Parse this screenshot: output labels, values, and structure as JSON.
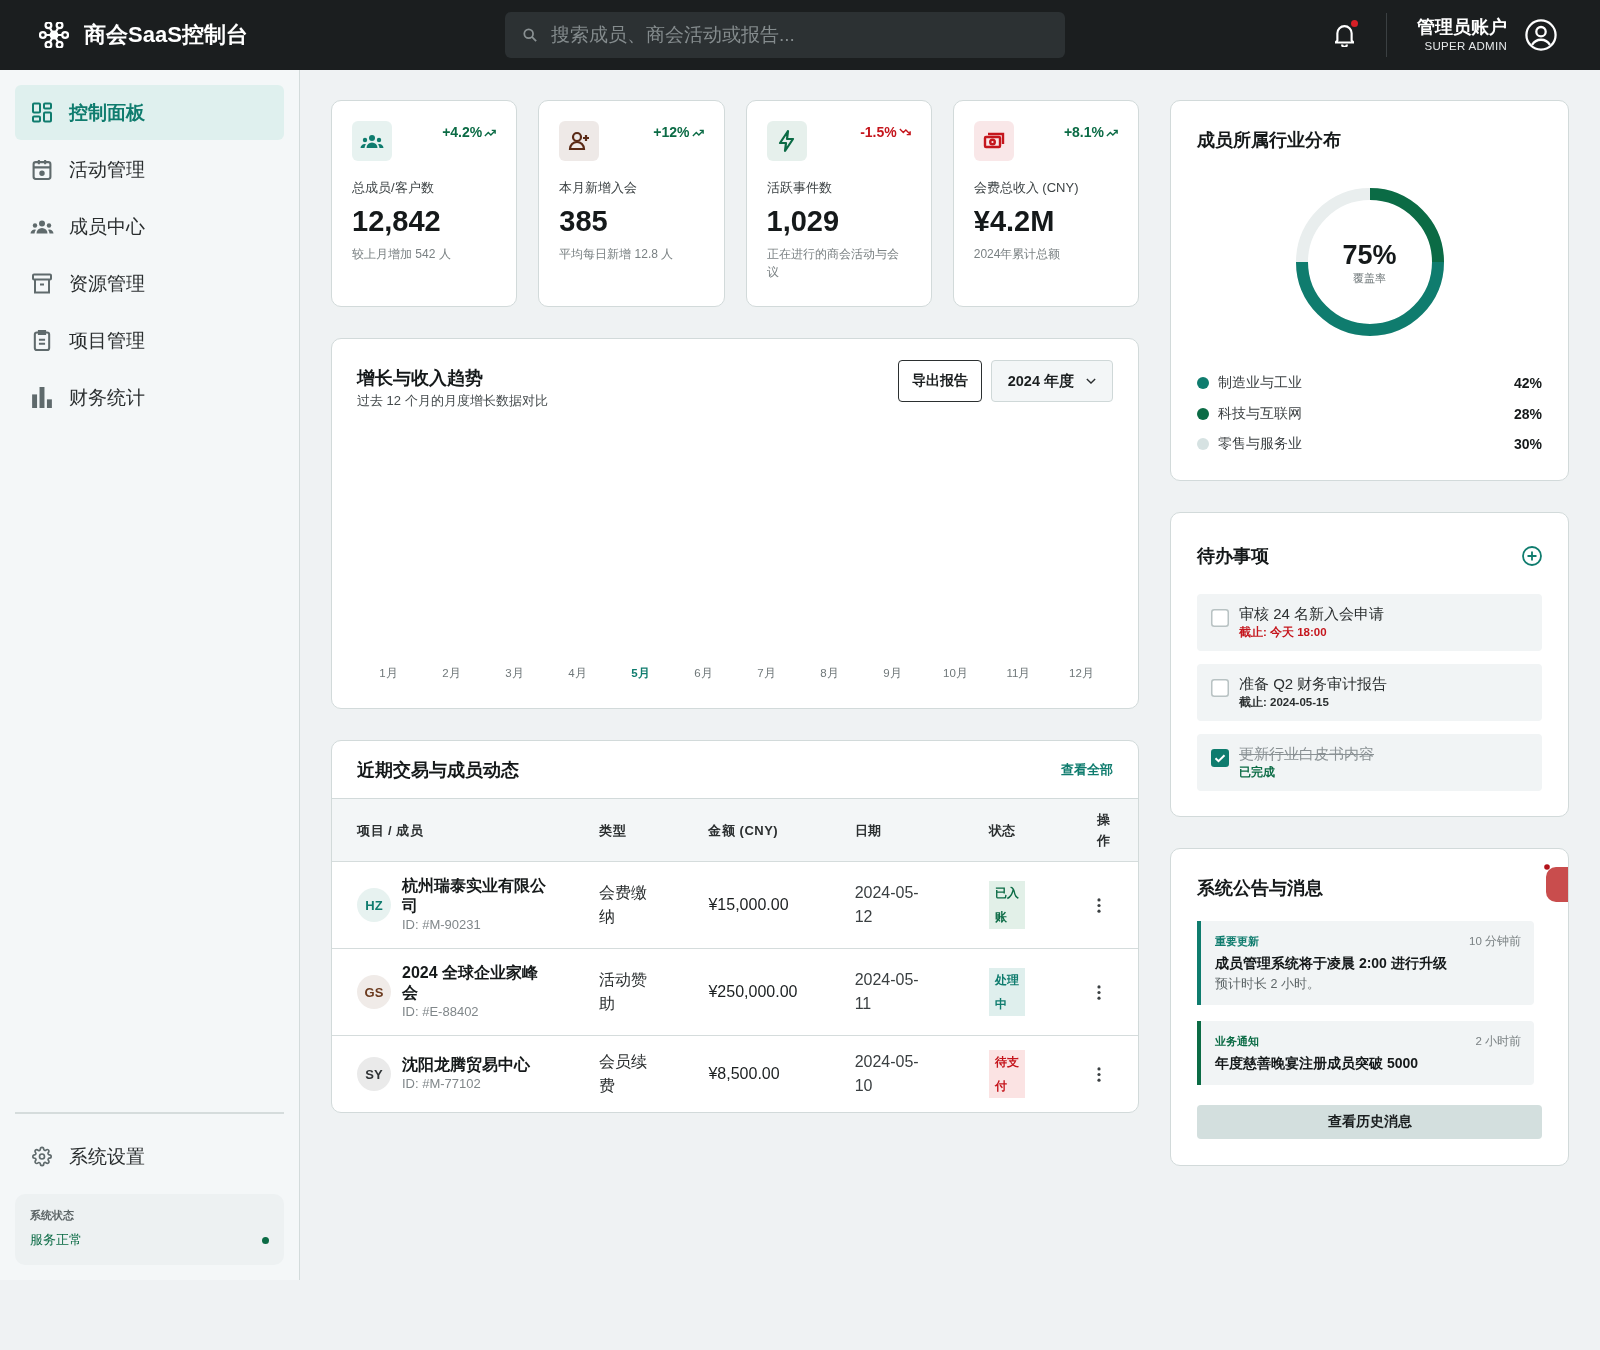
{
  "header": {
    "title": "商会SaaS控制台",
    "search": {
      "placeholder": "搜索成员、商会活动或报告..."
    },
    "notifications": {
      "unread": true
    },
    "account": {
      "name": "管理员账户",
      "role": "SUPER ADMIN"
    }
  },
  "sidebar": {
    "items": [
      {
        "label": "控制面板",
        "selected": true
      },
      {
        "label": "活动管理",
        "selected": false
      },
      {
        "label": "成员中心",
        "selected": false
      },
      {
        "label": "资源管理",
        "selected": false
      },
      {
        "label": "项目管理",
        "selected": false
      },
      {
        "label": "财务统计",
        "selected": false
      }
    ],
    "settings_item": {
      "label": "系统设置"
    },
    "status": {
      "title": "系统状态",
      "text": "服务正常",
      "color": "#0b6b45"
    }
  },
  "stats": [
    {
      "label": "总成员/客户数",
      "value": "12,842",
      "note": "较上月增加 542 人",
      "change": "+4.2%",
      "kind": "up",
      "color": "#0f7c6e"
    },
    {
      "label": "本月新增入会",
      "value": "385",
      "note": "平均每日新增 12.8 人",
      "change": "+12%",
      "kind": "up",
      "color": "#5a2a16"
    },
    {
      "label": "活跃事件数",
      "value": "1,029",
      "note": "正在进行的商会活动与会议",
      "change": "-1.5%",
      "kind": "down",
      "color": "#0b6b45"
    },
    {
      "label": "会费总收入 (CNY)",
      "value": "¥4.2M",
      "note": "2024年累计总额",
      "change": "+8.1%",
      "kind": "up",
      "color": "#c5161d"
    }
  ],
  "trend_card": {
    "title": "增长与收入趋势",
    "subtitle": "过去 12 个月的月度增长数据对比",
    "export_button": "导出报告",
    "year_select": {
      "value": "2024 年度"
    },
    "months": [
      {
        "label": "1月",
        "selected": false
      },
      {
        "label": "2月",
        "selected": false
      },
      {
        "label": "3月",
        "selected": false
      },
      {
        "label": "4月",
        "selected": false
      },
      {
        "label": "5月",
        "selected": true
      },
      {
        "label": "6月",
        "selected": false
      },
      {
        "label": "7月",
        "selected": false
      },
      {
        "label": "8月",
        "selected": false
      },
      {
        "label": "9月",
        "selected": false
      },
      {
        "label": "10月",
        "selected": false
      },
      {
        "label": "11月",
        "selected": false
      },
      {
        "label": "12月",
        "selected": false
      }
    ]
  },
  "transactions": {
    "title": "近期交易与成员动态",
    "view_all": "查看全部",
    "columns": [
      "项目 / 成员",
      "类型",
      "金额 (CNY)",
      "日期",
      "状态",
      "操作"
    ],
    "rows": [
      {
        "initials": "HZ",
        "color": "#0f7c6e",
        "name": "杭州瑞泰实业有限公司",
        "id": "ID: #M-90231",
        "type": "会费缴纳",
        "amount": "¥15,000.00",
        "date": "2024-05-12",
        "status": "已入账",
        "kind": "settled"
      },
      {
        "initials": "GS",
        "color": "#6b3a1e",
        "name": "2024 全球企业家峰会",
        "id": "ID: #E-88402",
        "type": "活动赞助",
        "amount": "¥250,000.00",
        "date": "2024-05-11",
        "status": "处理中",
        "kind": "processing"
      },
      {
        "initials": "SY",
        "color": "#2f3335",
        "name": "沈阳龙腾贸易中心",
        "id": "ID: #M-77102",
        "type": "会员续费",
        "amount": "¥8,500.00",
        "date": "2024-05-10",
        "status": "待支付",
        "kind": "pending"
      }
    ]
  },
  "industry": {
    "title": "成员所属行业分布",
    "donut": {
      "value": "75%",
      "caption": "覆盖率"
    },
    "legend": [
      {
        "label": "制造业与工业",
        "value": "42%",
        "color": "#0f7c6e"
      },
      {
        "label": "科技与互联网",
        "value": "28%",
        "color": "#0b6b45"
      },
      {
        "label": "零售与服务业",
        "value": "30%",
        "color": "#d6e2e2"
      }
    ]
  },
  "todos": {
    "title": "待办事项",
    "items": [
      {
        "text": "审核 24 名新入会申请",
        "note": "截止: 今天 18:00",
        "kind": "urgent",
        "checked": false
      },
      {
        "text": "准备 Q2 财务审计报告",
        "note": "截止: 2024-05-15",
        "kind": "normal",
        "checked": false
      },
      {
        "text": "更新行业白皮书内容",
        "note": "已完成",
        "kind": "done",
        "checked": true
      }
    ]
  },
  "announcements": {
    "title": "系统公告与消息",
    "items": [
      {
        "tag": "重要更新",
        "time": "10 分钟前",
        "title": "成员管理系统将于凌晨 2:00 进行升级",
        "detail": "预计时长 2 小时。",
        "color": "#0f7c6e"
      },
      {
        "tag": "业务通知",
        "time": "2 小时前",
        "title": "年度慈善晚宴注册成员突破 5000",
        "color": "#0b6b45"
      }
    ],
    "history_button": "查看历史消息"
  }
}
